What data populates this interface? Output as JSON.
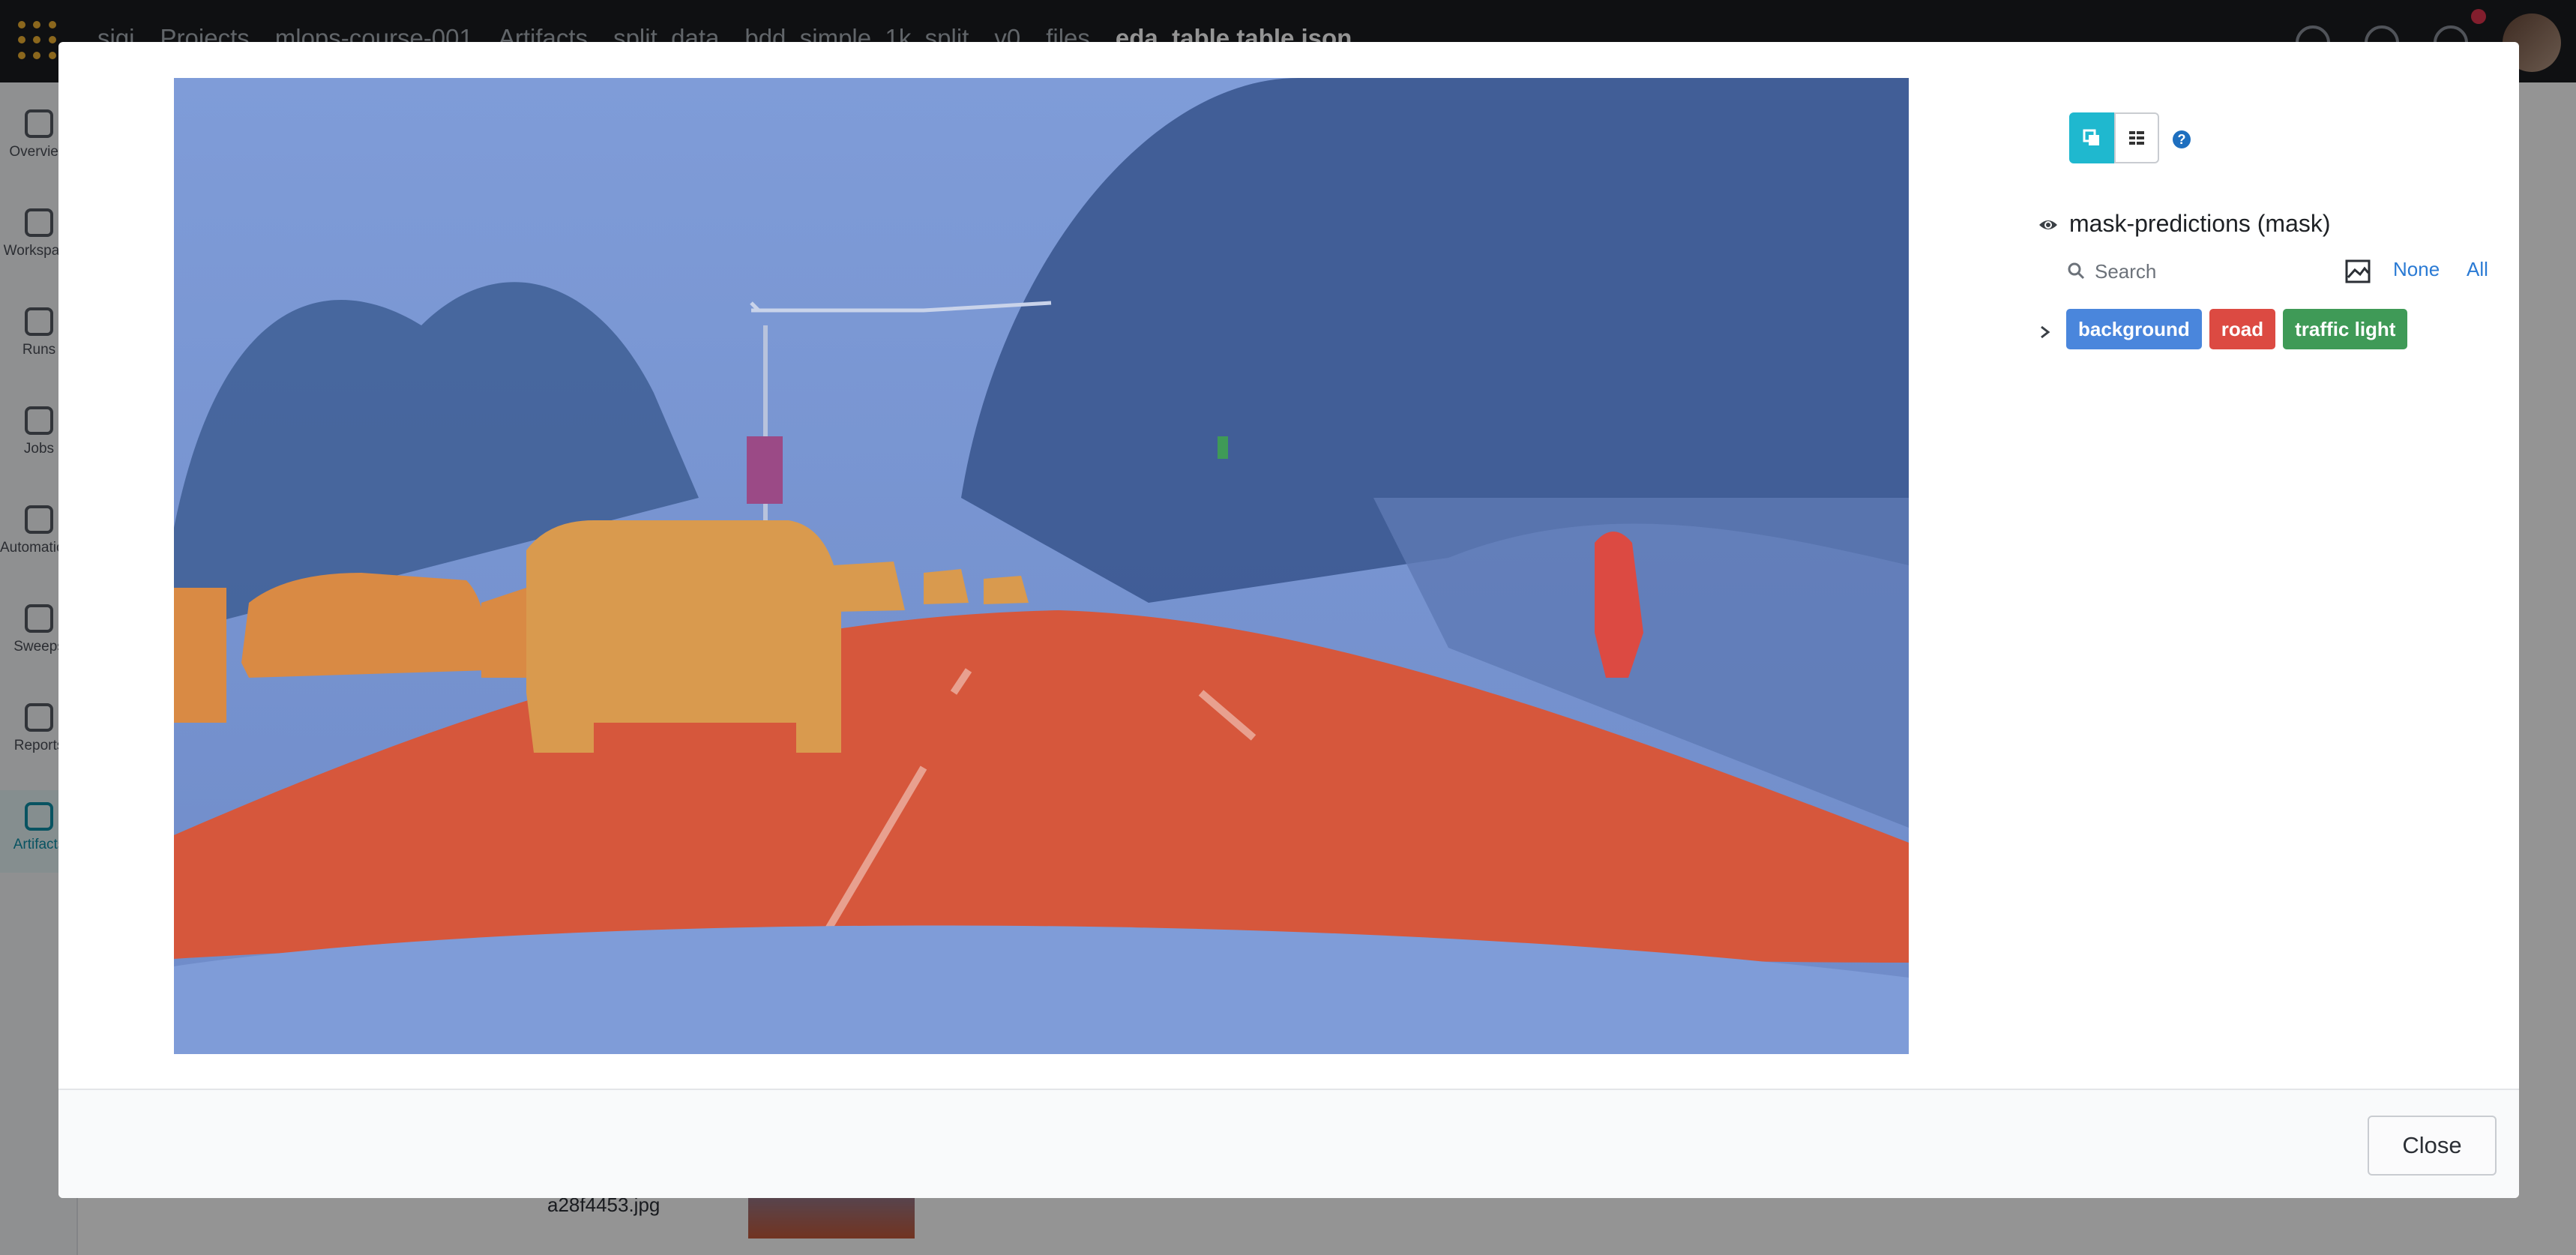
{
  "breadcrumb": [
    "sigi",
    "Projects",
    "mlops-course-001",
    "Artifacts",
    "split_data",
    "bdd_simple_1k_split",
    "v0",
    "files",
    "eda_table.table.json"
  ],
  "sidebar": {
    "items": [
      {
        "label": "Overview"
      },
      {
        "label": "Workspace"
      },
      {
        "label": "Runs"
      },
      {
        "label": "Jobs"
      },
      {
        "label": "Automations"
      },
      {
        "label": "Sweeps"
      },
      {
        "label": "Reports"
      },
      {
        "label": "Artifacts"
      }
    ]
  },
  "background": {
    "row_filename": "a28f4453.jpg"
  },
  "panel": {
    "mask_title": "mask-predictions (mask)",
    "search_placeholder": "Search",
    "none_label": "None",
    "all_label": "All",
    "classes": [
      {
        "label": "background",
        "color": "#4a86dc"
      },
      {
        "label": "road",
        "color": "#dc4a42"
      },
      {
        "label": "traffic light",
        "color": "#3f9a57"
      }
    ]
  },
  "mask_colors": {
    "background": "#6f8fd0",
    "road": "#d6573c",
    "car": "#d99a4e",
    "person": "#dc4a42"
  },
  "footer": {
    "close_label": "Close"
  }
}
